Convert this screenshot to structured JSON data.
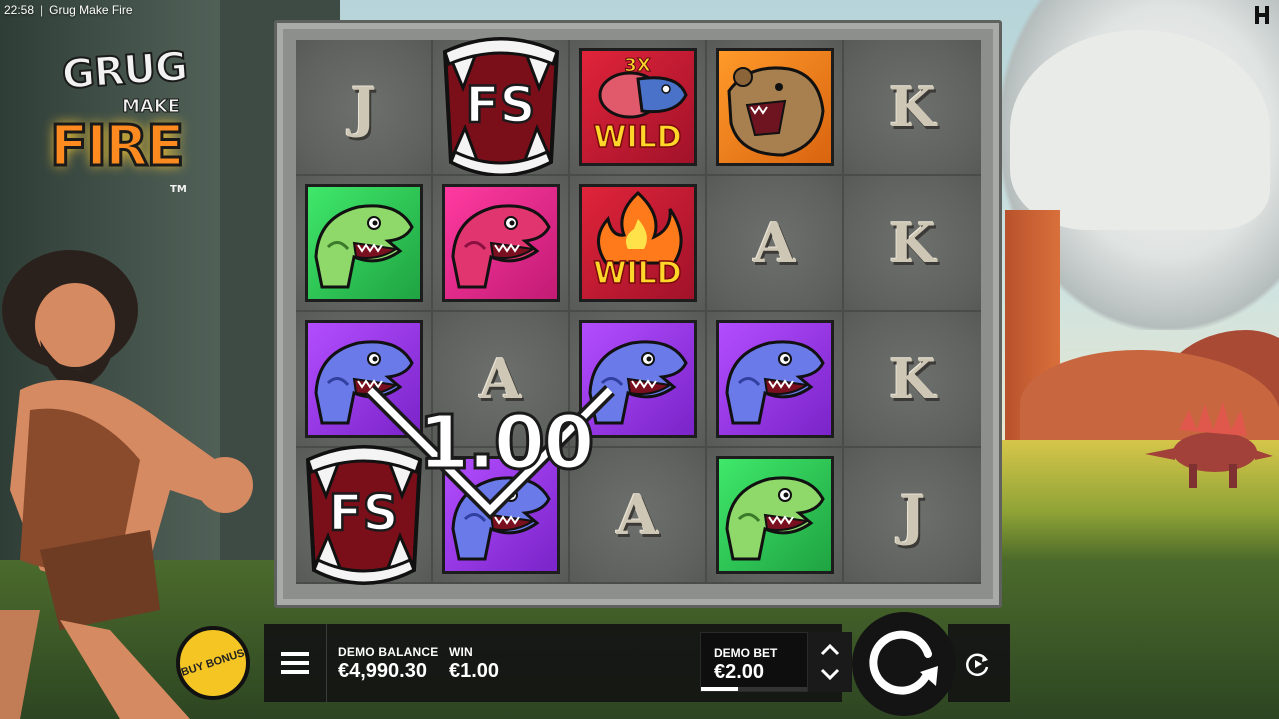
{
  "system": {
    "time": "22:58",
    "separator": "|",
    "game_title": "Grug Make Fire"
  },
  "logo": {
    "line1": "GRUG",
    "line2": "MAKE",
    "line3": "FIRE",
    "tm": "TM"
  },
  "reels": {
    "rows": [
      [
        {
          "type": "card",
          "label": "J"
        },
        {
          "type": "scatter",
          "label": "FS"
        },
        {
          "type": "wild",
          "label": "WILD",
          "multiplier": "3X",
          "icon": "meat-icon"
        },
        {
          "type": "animal",
          "icon": "bear-icon",
          "color": "#ff9a2a"
        },
        {
          "type": "card",
          "label": "K"
        }
      ],
      [
        {
          "type": "animal",
          "icon": "green-dino-icon",
          "color": "#3fe86a"
        },
        {
          "type": "animal",
          "icon": "pink-dino-icon",
          "color": "#ff3aa0"
        },
        {
          "type": "wild",
          "label": "WILD",
          "multiplier": "",
          "icon": "fire-icon"
        },
        {
          "type": "card",
          "label": "A"
        },
        {
          "type": "card",
          "label": "K"
        }
      ],
      [
        {
          "type": "animal",
          "icon": "purple-dino-icon",
          "color": "#b34dff"
        },
        {
          "type": "card",
          "label": "A"
        },
        {
          "type": "animal",
          "icon": "purple-dino-icon",
          "color": "#b34dff"
        },
        {
          "type": "animal",
          "icon": "purple-dino-icon",
          "color": "#b34dff"
        },
        {
          "type": "card",
          "label": "K"
        }
      ],
      [
        {
          "type": "scatter",
          "label": "FS"
        },
        {
          "type": "animal",
          "icon": "purple-dino-icon",
          "color": "#b34dff"
        },
        {
          "type": "card",
          "label": "A"
        },
        {
          "type": "animal",
          "icon": "green-dino-icon",
          "color": "#3fe86a"
        },
        {
          "type": "card",
          "label": "J"
        }
      ]
    ]
  },
  "win_overlay": {
    "amount": "1.00"
  },
  "controls": {
    "buy_bonus_label": "BUY BONUS",
    "balance_label": "DEMO BALANCE",
    "balance_value": "€4,990.30",
    "win_label": "WIN",
    "win_value": "€1.00",
    "bet_label": "DEMO BET",
    "bet_value": "€2.00",
    "bet_level_fraction": 0.35
  },
  "colors": {
    "buy_bonus": "#f5c524",
    "panel": "#141414",
    "wild_text": "#ffd62a"
  }
}
